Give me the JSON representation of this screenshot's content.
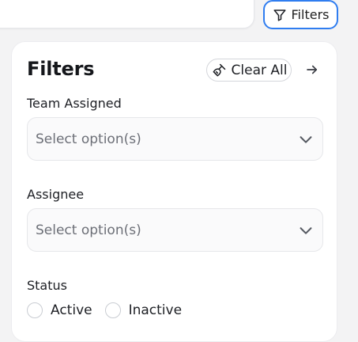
{
  "header": {
    "filters_button_label": "Filters",
    "filter_icon": "funnel-icon"
  },
  "panel": {
    "title": "Filters",
    "clear_all_label": "Clear All",
    "clear_icon": "broom-icon",
    "collapse_icon": "arrow-right-icon"
  },
  "fields": {
    "team_assigned": {
      "label": "Team Assigned",
      "placeholder": "Select option(s)"
    },
    "assignee": {
      "label": "Assignee",
      "placeholder": "Select option(s)"
    },
    "status": {
      "label": "Status",
      "options": [
        "Active",
        "Inactive"
      ]
    }
  },
  "colors": {
    "accent": "#2f7df0",
    "panel_bg": "#ffffff",
    "page_bg": "#f3f3f4"
  }
}
